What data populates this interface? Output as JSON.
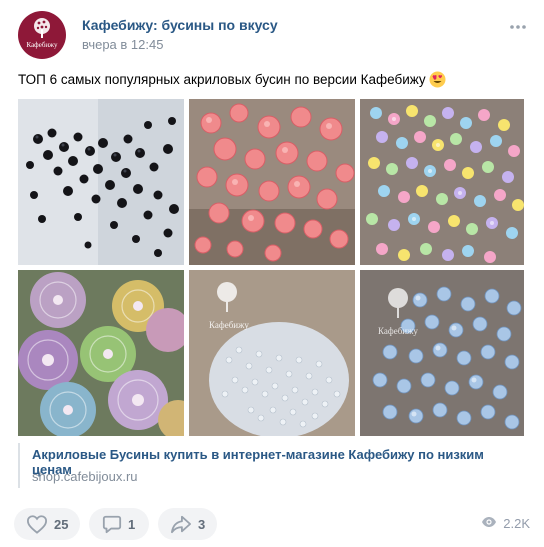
{
  "post": {
    "author": "Кафебижу: бусины по вкусу",
    "time": "вчера в 12:45",
    "avatar_text": "Кафебижу",
    "text": "ТОП 6 самых популярных акриловых бусин по версии Кафебижу",
    "emoji": "heart-eyes-emoji",
    "watermark": "Кафебижу"
  },
  "link": {
    "title": "Акриловые Бусины купить в интернет-магазине Кафебижу по низким ценам",
    "domain": "shop.cafebijoux.ru"
  },
  "actions": {
    "likes": "25",
    "comments": "1",
    "shares": "3",
    "views": "2.2K"
  },
  "icons": {
    "more": "more-horizontal-icon",
    "like": "heart-icon",
    "comment": "comment-icon",
    "share": "share-icon",
    "views": "eye-icon"
  },
  "colors": {
    "link": "#2a5885",
    "secondary": "#818c99",
    "button_bg": "#f2f3f5",
    "avatar": "#8e1838"
  }
}
